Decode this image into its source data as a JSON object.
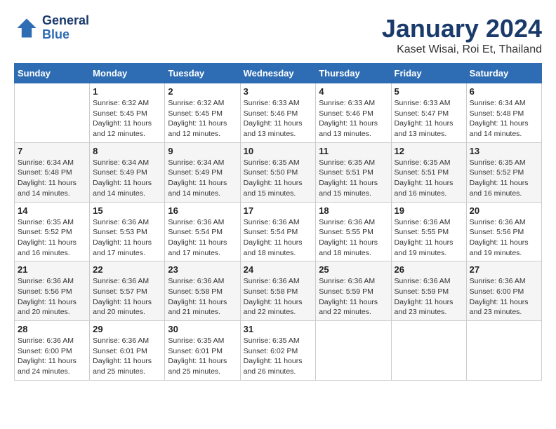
{
  "header": {
    "logo_line1": "General",
    "logo_line2": "Blue",
    "title": "January 2024",
    "subtitle": "Kaset Wisai, Roi Et, Thailand"
  },
  "calendar": {
    "days_of_week": [
      "Sunday",
      "Monday",
      "Tuesday",
      "Wednesday",
      "Thursday",
      "Friday",
      "Saturday"
    ],
    "weeks": [
      [
        {
          "day": "",
          "info": ""
        },
        {
          "day": "1",
          "info": "Sunrise: 6:32 AM\nSunset: 5:45 PM\nDaylight: 11 hours\nand 12 minutes."
        },
        {
          "day": "2",
          "info": "Sunrise: 6:32 AM\nSunset: 5:45 PM\nDaylight: 11 hours\nand 12 minutes."
        },
        {
          "day": "3",
          "info": "Sunrise: 6:33 AM\nSunset: 5:46 PM\nDaylight: 11 hours\nand 13 minutes."
        },
        {
          "day": "4",
          "info": "Sunrise: 6:33 AM\nSunset: 5:46 PM\nDaylight: 11 hours\nand 13 minutes."
        },
        {
          "day": "5",
          "info": "Sunrise: 6:33 AM\nSunset: 5:47 PM\nDaylight: 11 hours\nand 13 minutes."
        },
        {
          "day": "6",
          "info": "Sunrise: 6:34 AM\nSunset: 5:48 PM\nDaylight: 11 hours\nand 14 minutes."
        }
      ],
      [
        {
          "day": "7",
          "info": "Sunrise: 6:34 AM\nSunset: 5:48 PM\nDaylight: 11 hours\nand 14 minutes."
        },
        {
          "day": "8",
          "info": "Sunrise: 6:34 AM\nSunset: 5:49 PM\nDaylight: 11 hours\nand 14 minutes."
        },
        {
          "day": "9",
          "info": "Sunrise: 6:34 AM\nSunset: 5:49 PM\nDaylight: 11 hours\nand 14 minutes."
        },
        {
          "day": "10",
          "info": "Sunrise: 6:35 AM\nSunset: 5:50 PM\nDaylight: 11 hours\nand 15 minutes."
        },
        {
          "day": "11",
          "info": "Sunrise: 6:35 AM\nSunset: 5:51 PM\nDaylight: 11 hours\nand 15 minutes."
        },
        {
          "day": "12",
          "info": "Sunrise: 6:35 AM\nSunset: 5:51 PM\nDaylight: 11 hours\nand 16 minutes."
        },
        {
          "day": "13",
          "info": "Sunrise: 6:35 AM\nSunset: 5:52 PM\nDaylight: 11 hours\nand 16 minutes."
        }
      ],
      [
        {
          "day": "14",
          "info": "Sunrise: 6:35 AM\nSunset: 5:52 PM\nDaylight: 11 hours\nand 16 minutes."
        },
        {
          "day": "15",
          "info": "Sunrise: 6:36 AM\nSunset: 5:53 PM\nDaylight: 11 hours\nand 17 minutes."
        },
        {
          "day": "16",
          "info": "Sunrise: 6:36 AM\nSunset: 5:54 PM\nDaylight: 11 hours\nand 17 minutes."
        },
        {
          "day": "17",
          "info": "Sunrise: 6:36 AM\nSunset: 5:54 PM\nDaylight: 11 hours\nand 18 minutes."
        },
        {
          "day": "18",
          "info": "Sunrise: 6:36 AM\nSunset: 5:55 PM\nDaylight: 11 hours\nand 18 minutes."
        },
        {
          "day": "19",
          "info": "Sunrise: 6:36 AM\nSunset: 5:55 PM\nDaylight: 11 hours\nand 19 minutes."
        },
        {
          "day": "20",
          "info": "Sunrise: 6:36 AM\nSunset: 5:56 PM\nDaylight: 11 hours\nand 19 minutes."
        }
      ],
      [
        {
          "day": "21",
          "info": "Sunrise: 6:36 AM\nSunset: 5:56 PM\nDaylight: 11 hours\nand 20 minutes."
        },
        {
          "day": "22",
          "info": "Sunrise: 6:36 AM\nSunset: 5:57 PM\nDaylight: 11 hours\nand 20 minutes."
        },
        {
          "day": "23",
          "info": "Sunrise: 6:36 AM\nSunset: 5:58 PM\nDaylight: 11 hours\nand 21 minutes."
        },
        {
          "day": "24",
          "info": "Sunrise: 6:36 AM\nSunset: 5:58 PM\nDaylight: 11 hours\nand 22 minutes."
        },
        {
          "day": "25",
          "info": "Sunrise: 6:36 AM\nSunset: 5:59 PM\nDaylight: 11 hours\nand 22 minutes."
        },
        {
          "day": "26",
          "info": "Sunrise: 6:36 AM\nSunset: 5:59 PM\nDaylight: 11 hours\nand 23 minutes."
        },
        {
          "day": "27",
          "info": "Sunrise: 6:36 AM\nSunset: 6:00 PM\nDaylight: 11 hours\nand 23 minutes."
        }
      ],
      [
        {
          "day": "28",
          "info": "Sunrise: 6:36 AM\nSunset: 6:00 PM\nDaylight: 11 hours\nand 24 minutes."
        },
        {
          "day": "29",
          "info": "Sunrise: 6:36 AM\nSunset: 6:01 PM\nDaylight: 11 hours\nand 25 minutes."
        },
        {
          "day": "30",
          "info": "Sunrise: 6:35 AM\nSunset: 6:01 PM\nDaylight: 11 hours\nand 25 minutes."
        },
        {
          "day": "31",
          "info": "Sunrise: 6:35 AM\nSunset: 6:02 PM\nDaylight: 11 hours\nand 26 minutes."
        },
        {
          "day": "",
          "info": ""
        },
        {
          "day": "",
          "info": ""
        },
        {
          "day": "",
          "info": ""
        }
      ]
    ]
  }
}
